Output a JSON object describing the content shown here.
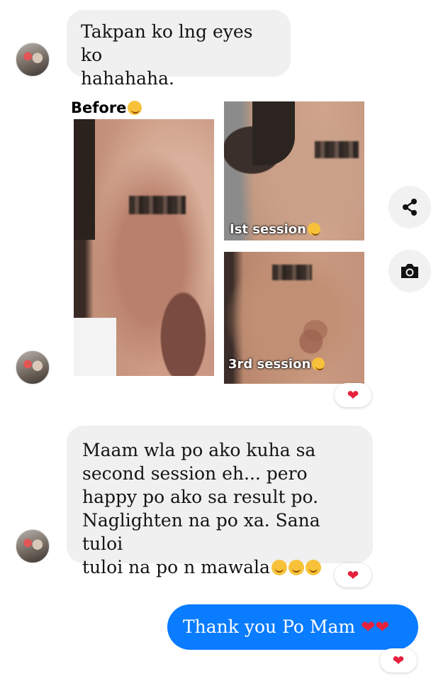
{
  "messages": [
    {
      "text": "Takpan ko lng eyes ko\nhahahaha."
    },
    {
      "text": "Maam wla po ako kuha sa\nsecond session eh... pero\nhappy po ako sa result po.\nNaglighten na po xa. Sana tuloi\ntuloi na po n mawala"
    },
    {
      "text": "Thank you Po Mam"
    }
  ],
  "photo": {
    "before_label": "Before",
    "session1_label": "Ist session",
    "session3_label": "3rd session"
  },
  "reactions": {
    "heart": "❤"
  },
  "icons": {
    "share": "share-icon",
    "camera": "camera-icon"
  },
  "colors": {
    "outgoing_bubble": "#0a7cff",
    "incoming_bubble": "#f0f0f0",
    "heart": "#e6213d"
  }
}
